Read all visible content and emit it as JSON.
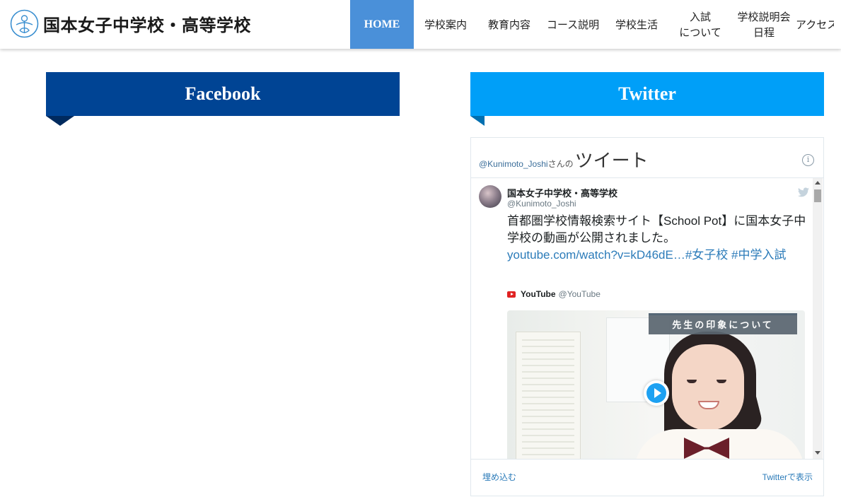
{
  "header": {
    "logo_text": "国本女子中学校・高等学校",
    "nav": [
      {
        "label": "HOME",
        "active": true
      },
      {
        "label": "学校案内"
      },
      {
        "label": "教育内容"
      },
      {
        "label": "コース説明"
      },
      {
        "label": "学校生活"
      },
      {
        "label_line1": "入試",
        "label_line2": "について"
      },
      {
        "label_line1": "学校説明会",
        "label_line2": "日程"
      },
      {
        "label": "アクセス"
      }
    ]
  },
  "sections": {
    "facebook_title": "Facebook",
    "twitter_title": "Twitter"
  },
  "twitter_embed": {
    "account": "@Kunimoto_Joshi",
    "account_suffix": "さんの",
    "heading": "ツイート",
    "tweet": {
      "author_name": "国本女子中学校・高等学校",
      "author_handle": "@Kunimoto_Joshi",
      "text": "首都圏学校情報検索サイト【School Pot】に国本女子中学校の動画が公開されました。",
      "link_text": "youtube.com/watch?v=kD46dE…#女子校 #中学入試",
      "card_source_name": "YouTube",
      "card_source_handle": "@YouTube",
      "video_caption": "先生の印象について"
    },
    "footer_embed": "埋め込む",
    "footer_view": "Twitterで表示"
  },
  "colors": {
    "nav_active": "#4a90d9",
    "facebook": "#004494",
    "twitter": "#009ff8",
    "link": "#2b7bb9"
  }
}
